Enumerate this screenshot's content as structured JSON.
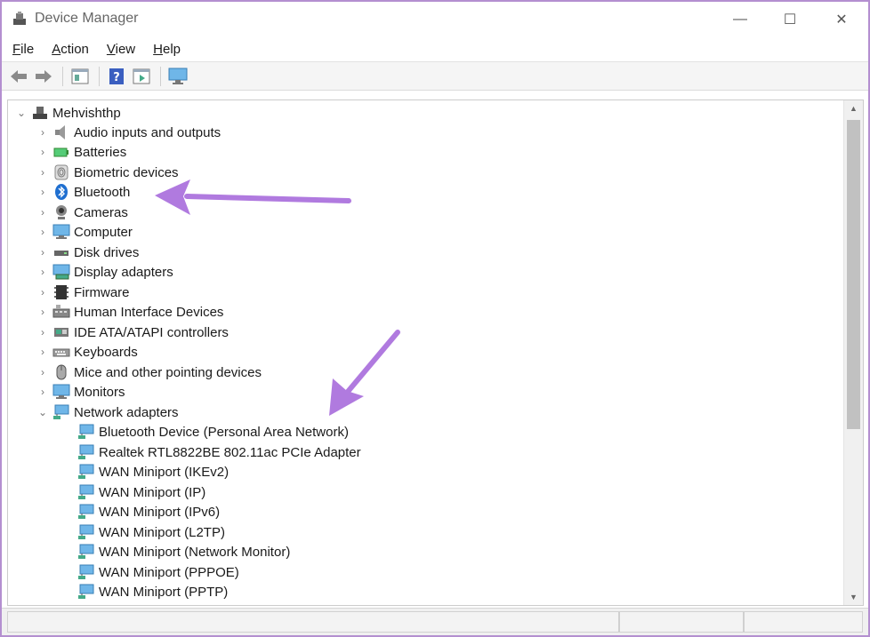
{
  "window": {
    "title": "Device Manager",
    "minimize_glyph": "—",
    "maximize_glyph": "☐",
    "close_glyph": "✕"
  },
  "menu": {
    "items": [
      {
        "label": "File"
      },
      {
        "label": "Action"
      },
      {
        "label": "View"
      },
      {
        "label": "Help"
      }
    ]
  },
  "toolbar": {
    "buttons": [
      "back-icon",
      "forward-icon",
      "properties-icon",
      "help-icon",
      "view-icon",
      "monitor-icon"
    ]
  },
  "tree": {
    "root": {
      "label": "Mehvishthp",
      "expanded": true,
      "icon": "computer-tree-icon"
    },
    "categories": [
      {
        "label": "Audio inputs and outputs",
        "icon": "speaker-icon"
      },
      {
        "label": "Batteries",
        "icon": "battery-icon"
      },
      {
        "label": "Biometric devices",
        "icon": "fingerprint-icon"
      },
      {
        "label": "Bluetooth",
        "icon": "bluetooth-icon"
      },
      {
        "label": "Cameras",
        "icon": "camera-icon"
      },
      {
        "label": "Computer",
        "icon": "monitor-icon"
      },
      {
        "label": "Disk drives",
        "icon": "disk-icon"
      },
      {
        "label": "Display adapters",
        "icon": "display-adapter-icon"
      },
      {
        "label": "Firmware",
        "icon": "firmware-icon"
      },
      {
        "label": "Human Interface Devices",
        "icon": "hid-icon"
      },
      {
        "label": "IDE ATA/ATAPI controllers",
        "icon": "ide-icon"
      },
      {
        "label": "Keyboards",
        "icon": "keyboard-icon"
      },
      {
        "label": "Mice and other pointing devices",
        "icon": "mouse-icon"
      },
      {
        "label": "Monitors",
        "icon": "monitor-icon"
      },
      {
        "label": "Network adapters",
        "icon": "network-icon",
        "expanded": true
      }
    ],
    "network_children": [
      {
        "label": "Bluetooth Device (Personal Area Network)"
      },
      {
        "label": "Realtek RTL8822BE 802.11ac PCIe Adapter"
      },
      {
        "label": "WAN Miniport (IKEv2)"
      },
      {
        "label": "WAN Miniport (IP)"
      },
      {
        "label": "WAN Miniport (IPv6)"
      },
      {
        "label": "WAN Miniport (L2TP)"
      },
      {
        "label": "WAN Miniport (Network Monitor)"
      },
      {
        "label": "WAN Miniport (PPPOE)"
      },
      {
        "label": "WAN Miniport (PPTP)"
      }
    ]
  },
  "colors": {
    "annotation_arrow": "#b07adf",
    "window_border": "#b48fd0"
  }
}
